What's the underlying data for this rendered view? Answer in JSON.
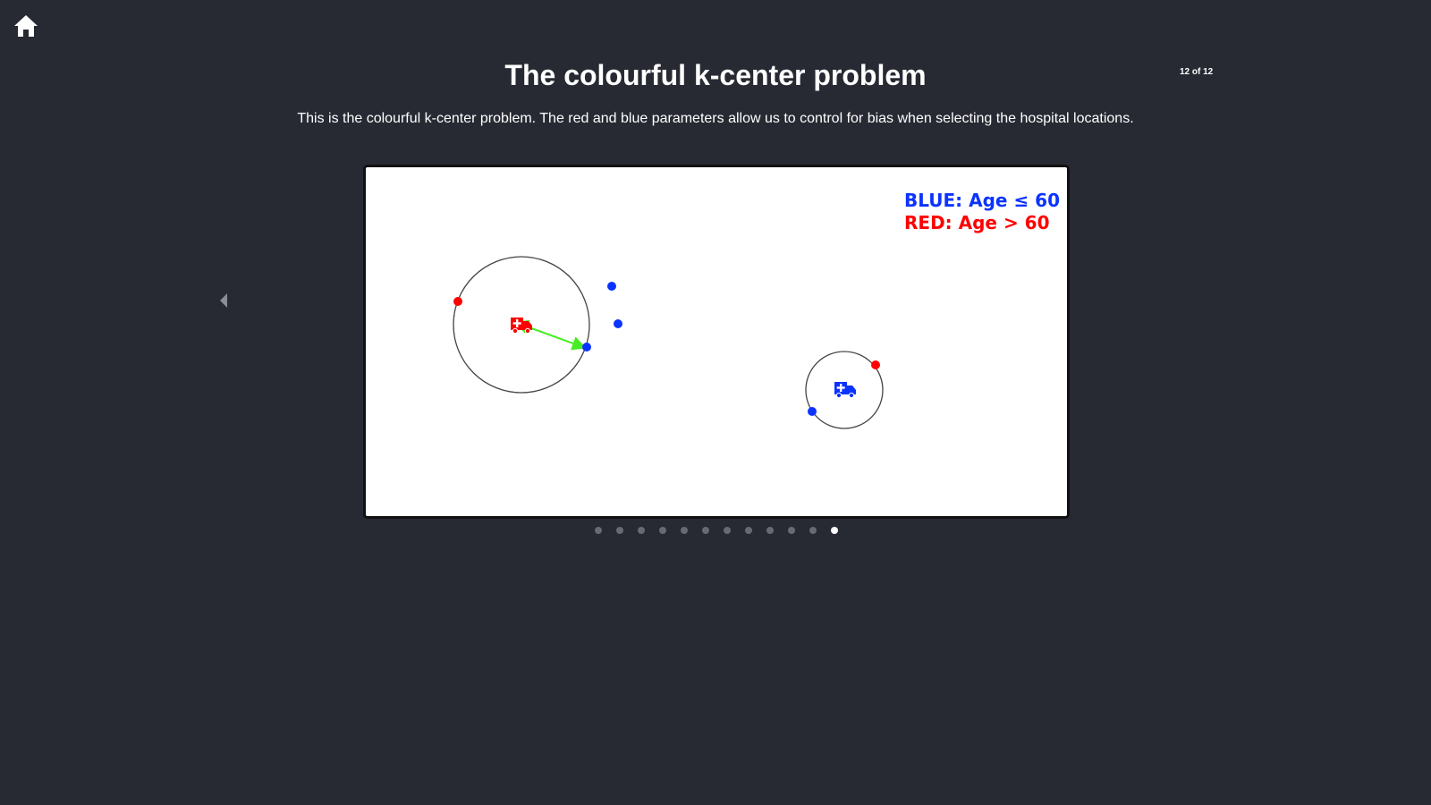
{
  "header": {
    "title": "The colourful k-center problem",
    "page_counter": "12 of 12",
    "description": "This is the colourful k-center problem. The red and blue parameters allow us to control for bias when selecting the hospital locations."
  },
  "icons": {
    "home": "home-icon",
    "prev": "chevron-left-icon",
    "hospital": "ambulance-icon"
  },
  "slide": {
    "legend": {
      "blue_label": "BLUE: Age ≤ 60",
      "red_label": "RED: Age > 60"
    },
    "colors": {
      "blue": "#0b33ff",
      "red": "#ff0000",
      "radius_arrow": "#44ee22",
      "circle": "#444444"
    }
  },
  "pagination": {
    "total": 12,
    "current": 12
  },
  "theme": {
    "background": "#272a33",
    "text": "#ffffff",
    "dot_inactive": "#666a73",
    "dot_active": "#ffffff"
  }
}
